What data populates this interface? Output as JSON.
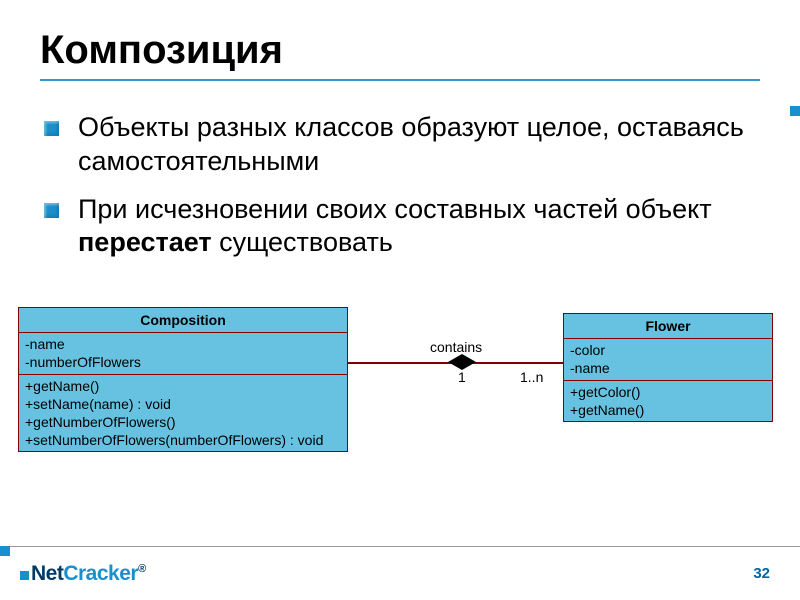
{
  "title": "Композиция",
  "bullets": [
    {
      "text": "Объекты разных классов образуют целое, оставаясь самостоятельными",
      "bold": ""
    },
    {
      "prefix": "При исчезновении своих составных частей объект ",
      "bold": "перестает",
      "suffix": " существовать"
    }
  ],
  "uml": {
    "left": {
      "name": "Composition",
      "attributes": [
        "-name",
        "-numberOfFlowers"
      ],
      "operations": [
        "+getName()",
        "+setName(name) : void",
        "+getNumberOfFlowers()",
        "+setNumberOfFlowers(numberOfFlowers) : void"
      ]
    },
    "right": {
      "name": "Flower",
      "attributes": [
        "-color",
        "-name"
      ],
      "operations": [
        "+getColor()",
        "+getName()"
      ]
    },
    "relation": {
      "label": "contains",
      "leftMult": "1",
      "rightMult": "1..n"
    }
  },
  "footer": {
    "logo_prefix": "Net",
    "logo_accent": "Cracker",
    "logo_reg": "®",
    "page": "32"
  }
}
